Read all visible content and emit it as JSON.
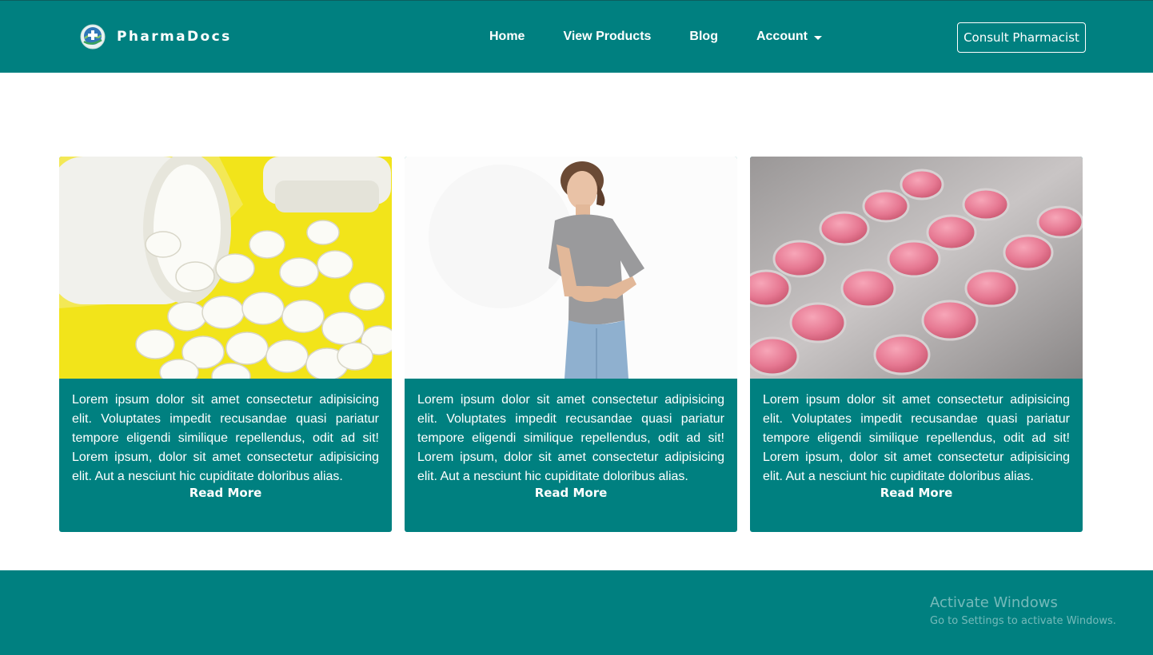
{
  "brand": {
    "name": "PharmaDocs",
    "logo_icon": "globe-cross-icon"
  },
  "nav": {
    "items": [
      {
        "label": "Home"
      },
      {
        "label": "View Products"
      },
      {
        "label": "Blog"
      },
      {
        "label": "Account",
        "icon": "chevron-down-icon"
      }
    ],
    "cta_label": "Consult Pharmacist"
  },
  "cards": [
    {
      "image": "pills-spilling-from-bottle",
      "text": "Lorem ipsum dolor sit amet consectetur adipisicing elit. Voluptates impedit recusandae quasi pariatur tempore eligendi similique repellendus, odit ad sit! Lorem ipsum, dolor sit amet consectetur adipisicing elit. Aut a nesciunt hic cupiditate doloribus alias.",
      "link_label": "Read More"
    },
    {
      "image": "woman-holding-stomach",
      "text": "Lorem ipsum dolor sit amet consectetur adipisicing elit. Voluptates impedit recusandae quasi pariatur tempore eligendi similique repellendus, odit ad sit! Lorem ipsum, dolor sit amet consectetur adipisicing elit. Aut a nesciunt hic cupiditate doloribus alias.",
      "link_label": "Read More"
    },
    {
      "image": "pink-pills-blister-pack",
      "text": "Lorem ipsum dolor sit amet consectetur adipisicing elit. Voluptates impedit recusandae quasi pariatur tempore eligendi similique repellendus, odit ad sit! Lorem ipsum, dolor sit amet consectetur adipisicing elit. Aut a nesciunt hic cupiditate doloribus alias.",
      "link_label": "Read More"
    }
  ],
  "watermark": {
    "title": "Activate Windows",
    "subtitle": "Go to Settings to activate Windows."
  },
  "colors": {
    "primary": "#008080",
    "text_on_primary": "#ffffff",
    "background": "#ffffff"
  }
}
